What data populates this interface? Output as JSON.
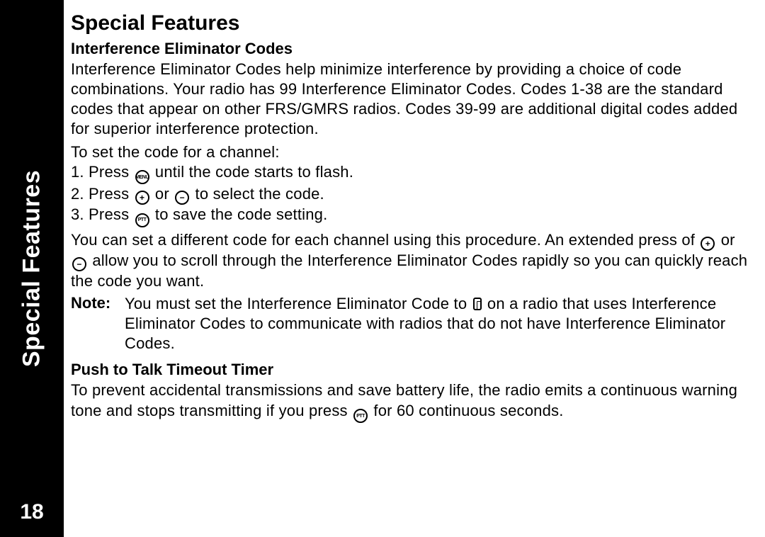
{
  "sidebar": {
    "label": "Special Features",
    "pageNumber": "18"
  },
  "title": "Special Features",
  "section1": {
    "heading": "Interference Eliminator Codes",
    "intro": "Interference Eliminator Codes help minimize interference by providing a choice of code combinations. Your radio has 99 Interference Eliminator Codes. Codes 1-38 are the standard codes that appear on other FRS/GMRS radios. Codes 39-99 are additional digital codes added for superior interference protection.",
    "lead": "To set the code for a channel:",
    "steps": {
      "s1a": "1. Press ",
      "s1b": " until the code starts to flash.",
      "s2a": "2. Press ",
      "s2b": " or ",
      "s2c": " to select the code.",
      "s3a": "3. Press ",
      "s3b": " to save the code setting."
    },
    "scrollA": "You can set a different code for each channel using this procedure. An extended press of ",
    "scrollB": " or ",
    "scrollC": " allow you to scroll through the Interference Eliminator Codes rapidly so you can quickly reach the code you want.",
    "noteLabel": "Note:",
    "noteA": " You must set the Interference Eliminator Code to ",
    "noteB": " on a radio that uses Interference Eliminator Codes to communicate with radios that do not have Interference Eliminator Codes."
  },
  "section2": {
    "heading": "Push to Talk Timeout Timer",
    "bodyA": "To prevent accidental transmissions and save battery life, the radio emits a continuous warning tone and stops transmitting if you press ",
    "bodyB": " for 60 continuous seconds."
  },
  "icons": {
    "menu": "MENU",
    "plus": "+",
    "minus": "−",
    "ptt": "PTT"
  }
}
